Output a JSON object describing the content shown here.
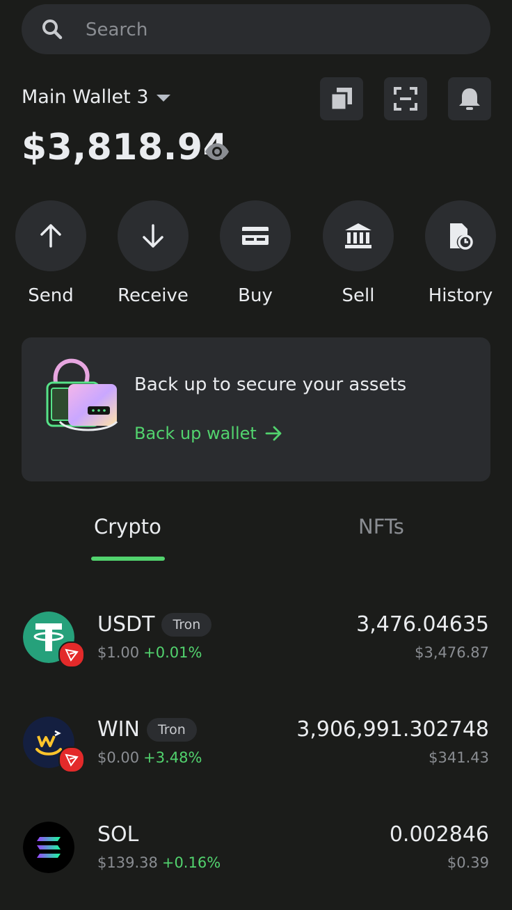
{
  "search": {
    "placeholder": "Search"
  },
  "wallet": {
    "name": "Main Wallet 3",
    "balance": "$3,818.94"
  },
  "actions": [
    {
      "label": "Send",
      "icon": "arrow-up-icon"
    },
    {
      "label": "Receive",
      "icon": "arrow-down-icon"
    },
    {
      "label": "Buy",
      "icon": "card-icon"
    },
    {
      "label": "Sell",
      "icon": "bank-icon"
    },
    {
      "label": "History",
      "icon": "history-icon"
    }
  ],
  "backup": {
    "title": "Back up to secure your assets",
    "link": "Back up wallet"
  },
  "tabs": [
    {
      "label": "Crypto",
      "active": true
    },
    {
      "label": "NFTs",
      "active": false
    }
  ],
  "assets": [
    {
      "symbol": "USDT",
      "network": "Tron",
      "price": "$1.00",
      "change": "+0.01%",
      "amount": "3,476.04635",
      "fiat": "$3,476.87"
    },
    {
      "symbol": "WIN",
      "network": "Tron",
      "price": "$0.00",
      "change": "+3.48%",
      "amount": "3,906,991.302748",
      "fiat": "$341.43"
    },
    {
      "symbol": "SOL",
      "network": "",
      "price": "$139.38",
      "change": "+0.16%",
      "amount": "0.002846",
      "fiat": "$0.39"
    }
  ],
  "colors": {
    "background": "#1b1c1a",
    "surface": "#2a2c2f",
    "accent": "#52d36e",
    "tron_red": "#e32a2a",
    "usdt_green": "#26a17b"
  }
}
